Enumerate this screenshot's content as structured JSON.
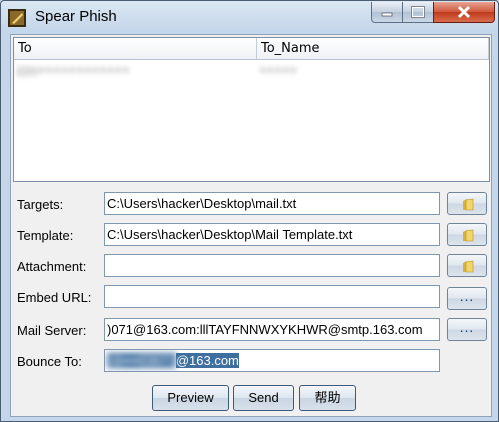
{
  "window": {
    "title": "Spear Phish",
    "app_icon": "spear-phish-app-icon",
    "controls": [
      "minimize",
      "maximize",
      "close"
    ]
  },
  "table": {
    "columns": [
      "To",
      "To_Name"
    ],
    "rows": [
      {
        "to": "zzo••••••••••••",
        "to_name": "•••••"
      }
    ]
  },
  "form": {
    "targets": {
      "label": "Targets:",
      "value": "C:\\Users\\hacker\\Desktop\\mail.txt",
      "button_icon": "folder-icon"
    },
    "template": {
      "label": "Template:",
      "value": "C:\\Users\\hacker\\Desktop\\Mail Template.txt",
      "button_icon": "folder-icon"
    },
    "attachment": {
      "label": "Attachment:",
      "value": "",
      "button_icon": "folder-icon"
    },
    "embed_url": {
      "label": "Embed URL:",
      "value": "",
      "button_label": "..."
    },
    "mail_server": {
      "label": "Mail Server:",
      "value": ")071@163.com:lllTAYFNNWXYKHWR@smtp.163.com",
      "button_label": "..."
    },
    "bounce_to": {
      "label": "Bounce To:",
      "value_prefix": "16••••03071",
      "value_suffix": "@163.com"
    }
  },
  "buttons": {
    "preview": "Preview",
    "send": "Send",
    "help": "帮助"
  }
}
